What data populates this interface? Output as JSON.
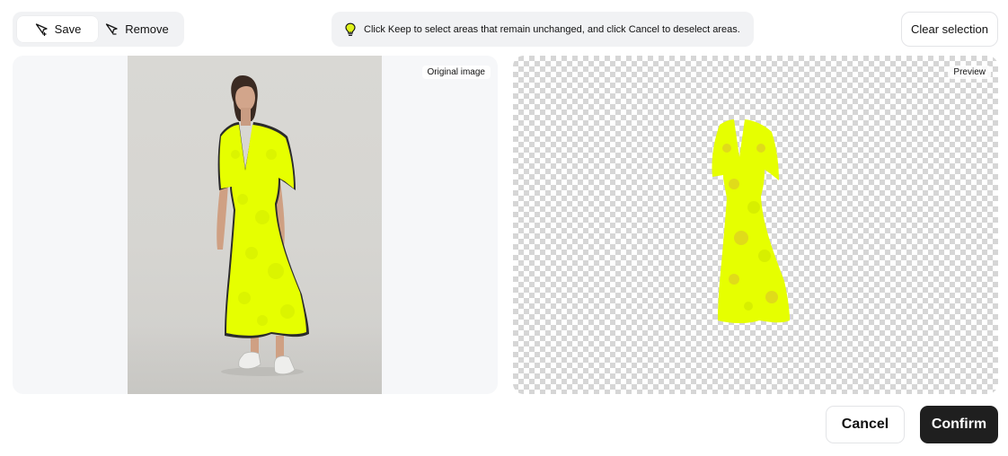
{
  "toolbar": {
    "save_label": "Save",
    "remove_label": "Remove",
    "active_mode": "Save"
  },
  "hint": {
    "text": "Click Keep to select areas that remain unchanged, and click Cancel to deselect areas.",
    "icon": "lightbulb-icon"
  },
  "clear_selection_label": "Clear selection",
  "panels": {
    "original_label": "Original image",
    "preview_label": "Preview"
  },
  "footer": {
    "cancel_label": "Cancel",
    "confirm_label": "Confirm"
  },
  "colors": {
    "mask": "#e6ff00",
    "confirm_bg": "#1f1f1f",
    "hint_bulb": "#d6f000"
  }
}
